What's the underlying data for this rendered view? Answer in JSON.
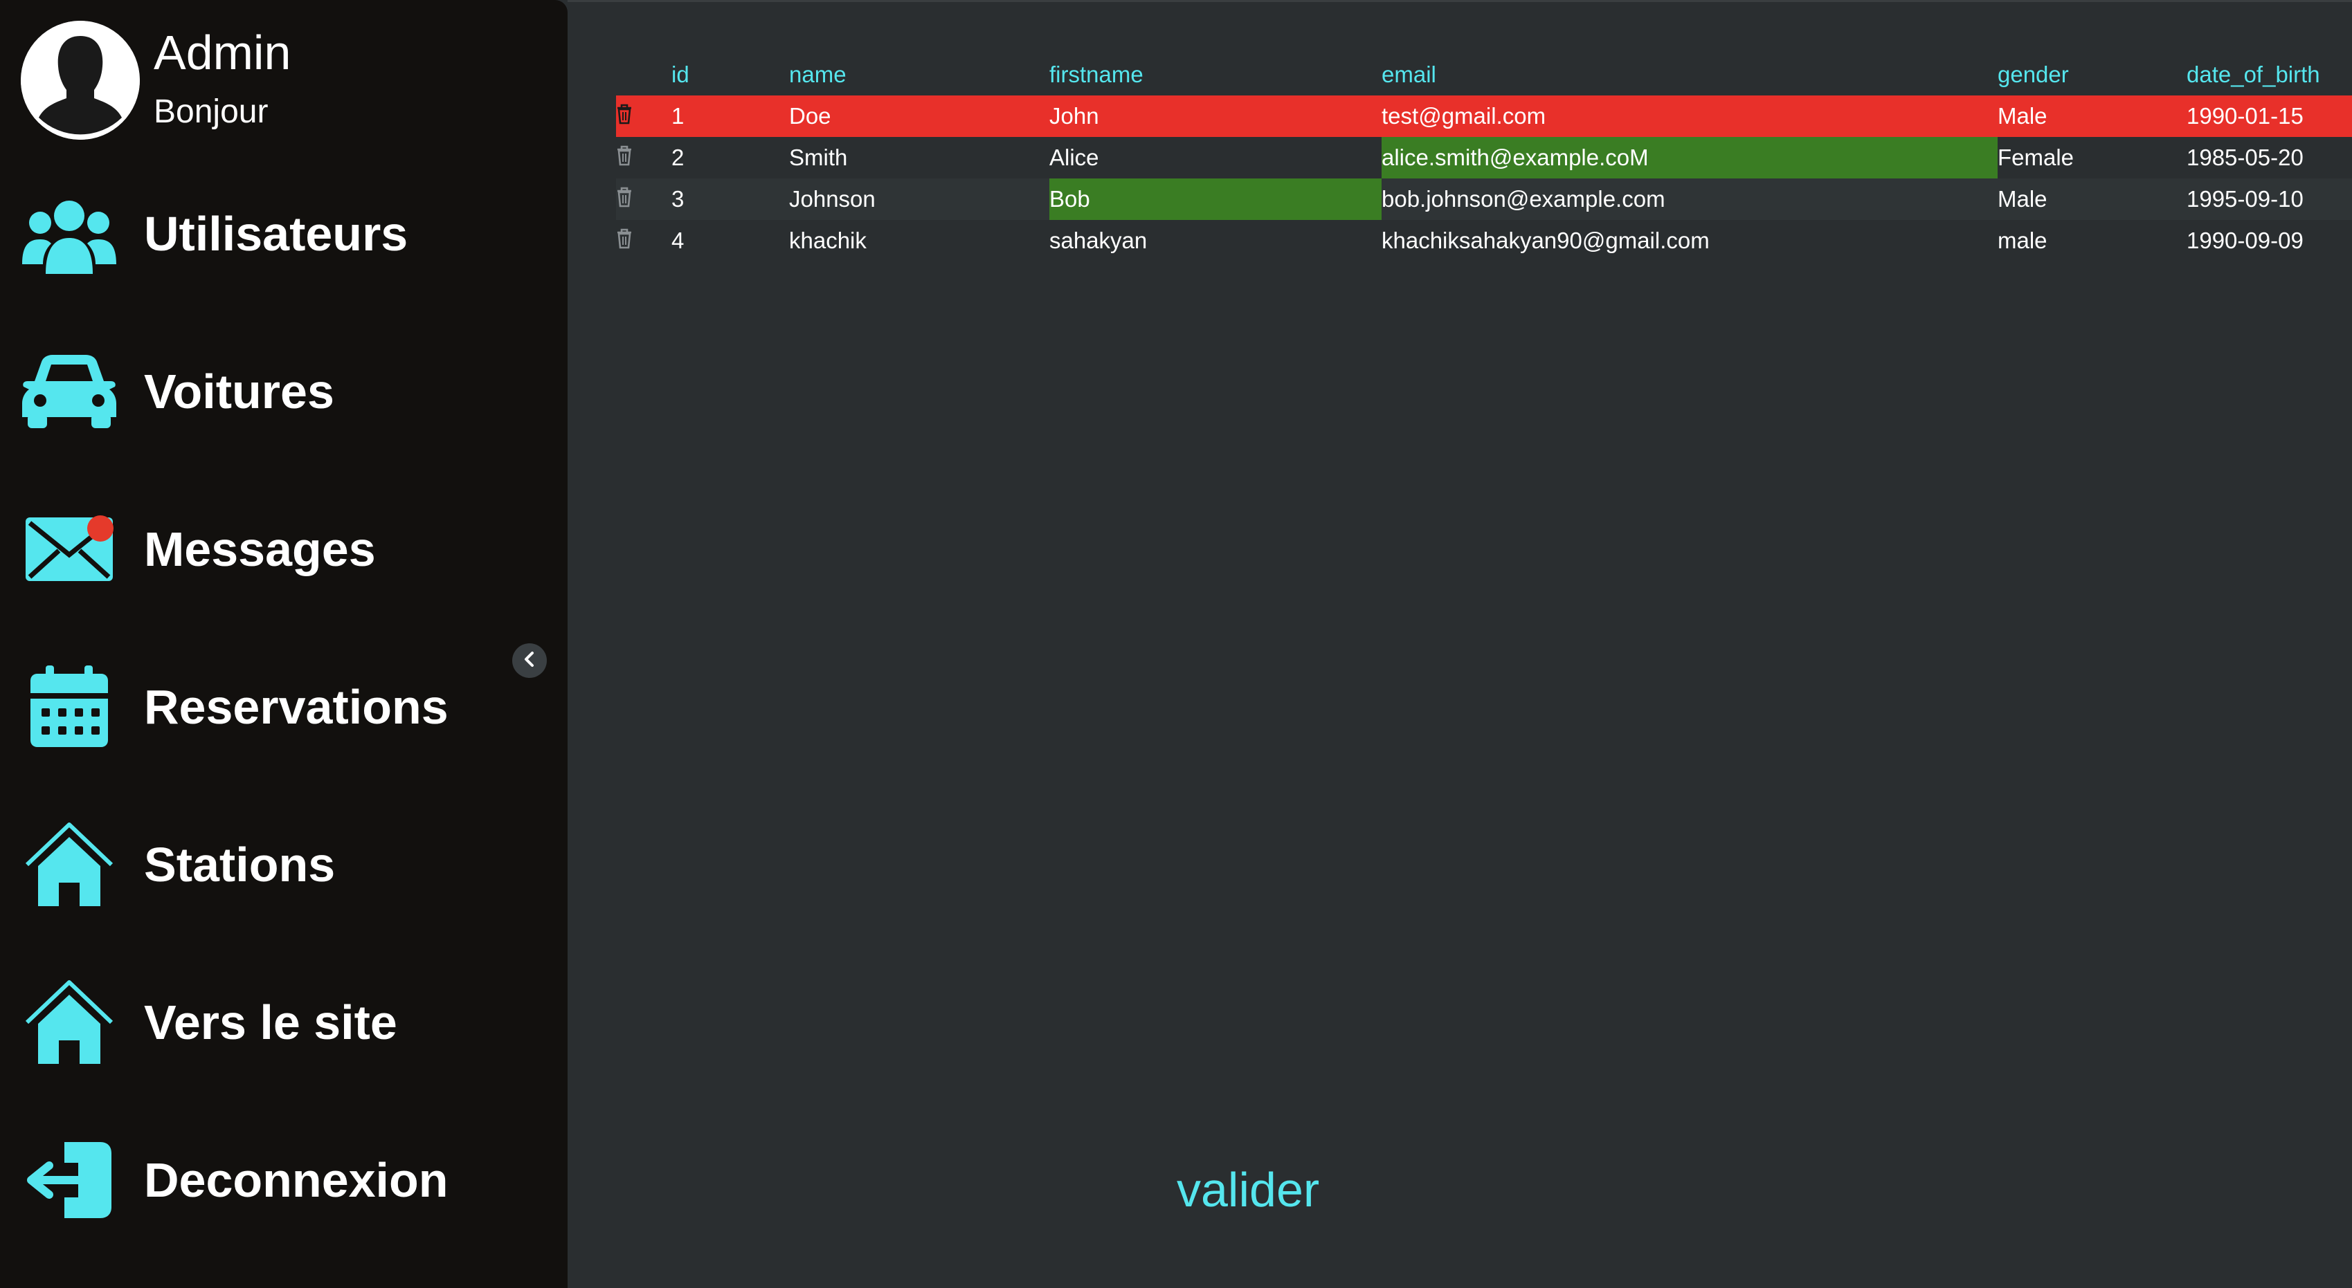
{
  "profile": {
    "name": "Admin",
    "greeting": "Bonjour"
  },
  "sidebar": {
    "items": [
      {
        "label": "Utilisateurs",
        "icon": "users-icon"
      },
      {
        "label": "Voitures",
        "icon": "car-icon"
      },
      {
        "label": "Messages",
        "icon": "envelope-icon",
        "notification": true
      },
      {
        "label": "Reservations",
        "icon": "calendar-icon"
      },
      {
        "label": "Stations",
        "icon": "home-icon"
      },
      {
        "label": "Vers le site",
        "icon": "home-icon"
      },
      {
        "label": "Deconnexion",
        "icon": "logout-icon"
      }
    ],
    "collapse_icon": "chevron-left-icon"
  },
  "table": {
    "headers": [
      "id",
      "name",
      "firstname",
      "email",
      "gender",
      "date_of_birth"
    ],
    "rows": [
      {
        "id": "1",
        "name": "Doe",
        "firstname": "John",
        "email": "test@gmail.com",
        "gender": "Male",
        "date_of_birth": "1990-01-15"
      },
      {
        "id": "2",
        "name": "Smith",
        "firstname": "Alice",
        "email": "alice.smith@example.coM",
        "gender": "Female",
        "date_of_birth": "1985-05-20"
      },
      {
        "id": "3",
        "name": "Johnson",
        "firstname": "Bob",
        "email": "bob.johnson@example.com",
        "gender": "Male",
        "date_of_birth": "1995-09-10"
      },
      {
        "id": "4",
        "name": "khachik",
        "firstname": "sahakyan",
        "email": "khachiksahakyan90@gmail.com",
        "gender": "male",
        "date_of_birth": "1990-09-09"
      }
    ],
    "delete_icon": "trash-icon"
  },
  "actions": {
    "validate_label": "valider"
  },
  "colors": {
    "accent": "#55e6ee",
    "sidebar_bg": "#12100e",
    "main_bg": "#2a2e30",
    "selected_row": "#e8302a",
    "edited_cell": "#3a7d23",
    "notification": "#e53a2b"
  }
}
